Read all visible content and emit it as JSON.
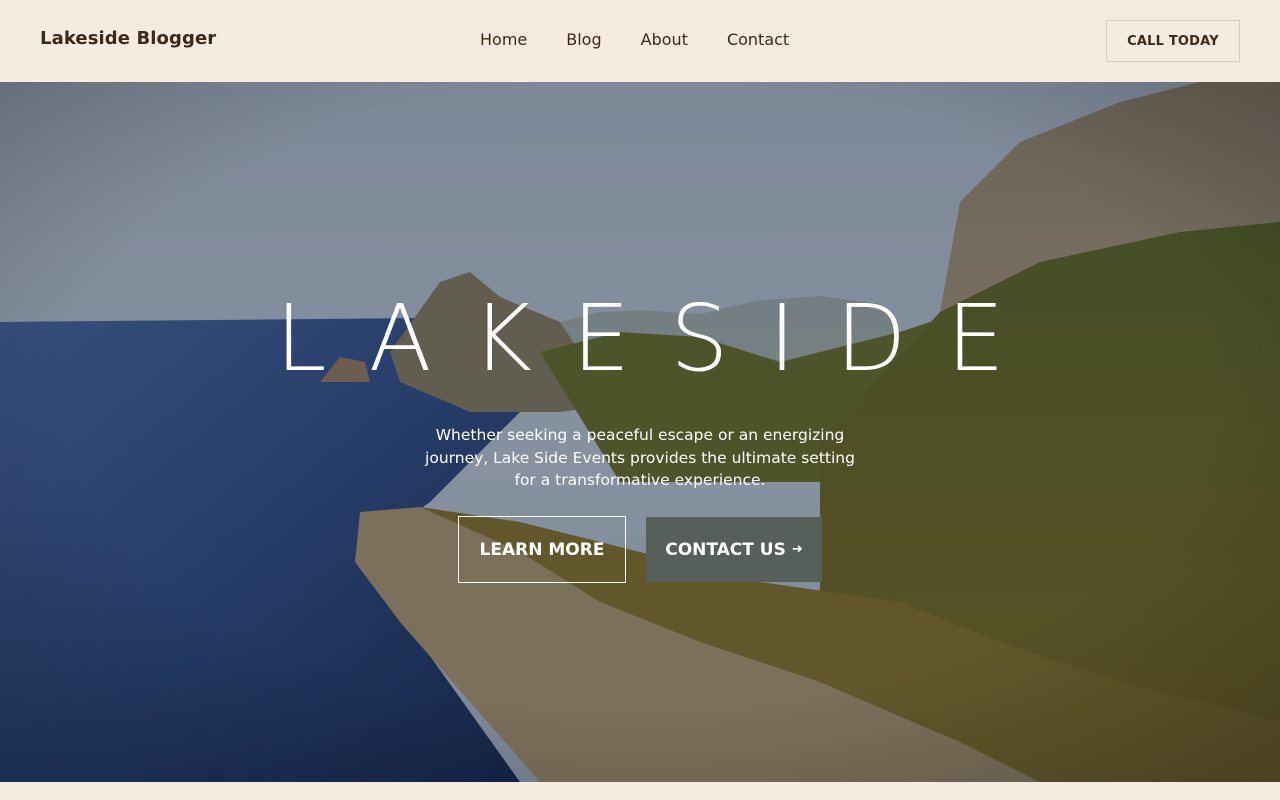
{
  "header": {
    "brand": "Lakeside Blogger",
    "nav": [
      "Home",
      "Blog",
      "About",
      "Contact"
    ],
    "cta_label": "CALL TODAY"
  },
  "hero": {
    "title": "LAKESIDE",
    "description": "Whether seeking a peaceful escape or an energizing journey, Lake Side Events provides the ultimate setting for a transformative experience.",
    "learn_more_label": "LEARN MORE",
    "contact_label": "CONTACT US",
    "contact_arrow_icon": "arrow-right-icon"
  },
  "colors": {
    "background": "#f6ebe0",
    "text": "#3a2a1c",
    "contact_button": "#575f5a"
  }
}
